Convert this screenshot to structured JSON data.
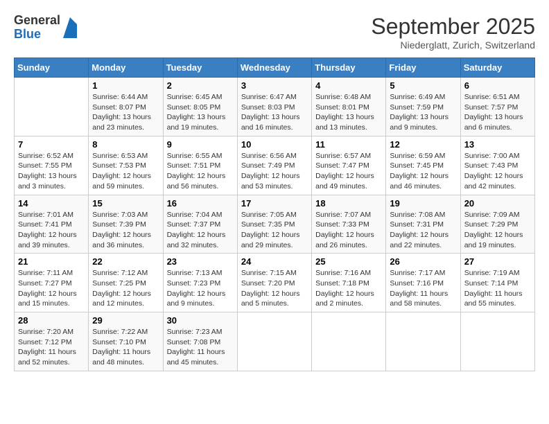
{
  "header": {
    "logo_general": "General",
    "logo_blue": "Blue",
    "month_title": "September 2025",
    "location": "Niederglatt, Zurich, Switzerland"
  },
  "days_of_week": [
    "Sunday",
    "Monday",
    "Tuesday",
    "Wednesday",
    "Thursday",
    "Friday",
    "Saturday"
  ],
  "weeks": [
    [
      {
        "day": "",
        "info": ""
      },
      {
        "day": "1",
        "info": "Sunrise: 6:44 AM\nSunset: 8:07 PM\nDaylight: 13 hours and 23 minutes."
      },
      {
        "day": "2",
        "info": "Sunrise: 6:45 AM\nSunset: 8:05 PM\nDaylight: 13 hours and 19 minutes."
      },
      {
        "day": "3",
        "info": "Sunrise: 6:47 AM\nSunset: 8:03 PM\nDaylight: 13 hours and 16 minutes."
      },
      {
        "day": "4",
        "info": "Sunrise: 6:48 AM\nSunset: 8:01 PM\nDaylight: 13 hours and 13 minutes."
      },
      {
        "day": "5",
        "info": "Sunrise: 6:49 AM\nSunset: 7:59 PM\nDaylight: 13 hours and 9 minutes."
      },
      {
        "day": "6",
        "info": "Sunrise: 6:51 AM\nSunset: 7:57 PM\nDaylight: 13 hours and 6 minutes."
      }
    ],
    [
      {
        "day": "7",
        "info": "Sunrise: 6:52 AM\nSunset: 7:55 PM\nDaylight: 13 hours and 3 minutes."
      },
      {
        "day": "8",
        "info": "Sunrise: 6:53 AM\nSunset: 7:53 PM\nDaylight: 12 hours and 59 minutes."
      },
      {
        "day": "9",
        "info": "Sunrise: 6:55 AM\nSunset: 7:51 PM\nDaylight: 12 hours and 56 minutes."
      },
      {
        "day": "10",
        "info": "Sunrise: 6:56 AM\nSunset: 7:49 PM\nDaylight: 12 hours and 53 minutes."
      },
      {
        "day": "11",
        "info": "Sunrise: 6:57 AM\nSunset: 7:47 PM\nDaylight: 12 hours and 49 minutes."
      },
      {
        "day": "12",
        "info": "Sunrise: 6:59 AM\nSunset: 7:45 PM\nDaylight: 12 hours and 46 minutes."
      },
      {
        "day": "13",
        "info": "Sunrise: 7:00 AM\nSunset: 7:43 PM\nDaylight: 12 hours and 42 minutes."
      }
    ],
    [
      {
        "day": "14",
        "info": "Sunrise: 7:01 AM\nSunset: 7:41 PM\nDaylight: 12 hours and 39 minutes."
      },
      {
        "day": "15",
        "info": "Sunrise: 7:03 AM\nSunset: 7:39 PM\nDaylight: 12 hours and 36 minutes."
      },
      {
        "day": "16",
        "info": "Sunrise: 7:04 AM\nSunset: 7:37 PM\nDaylight: 12 hours and 32 minutes."
      },
      {
        "day": "17",
        "info": "Sunrise: 7:05 AM\nSunset: 7:35 PM\nDaylight: 12 hours and 29 minutes."
      },
      {
        "day": "18",
        "info": "Sunrise: 7:07 AM\nSunset: 7:33 PM\nDaylight: 12 hours and 26 minutes."
      },
      {
        "day": "19",
        "info": "Sunrise: 7:08 AM\nSunset: 7:31 PM\nDaylight: 12 hours and 22 minutes."
      },
      {
        "day": "20",
        "info": "Sunrise: 7:09 AM\nSunset: 7:29 PM\nDaylight: 12 hours and 19 minutes."
      }
    ],
    [
      {
        "day": "21",
        "info": "Sunrise: 7:11 AM\nSunset: 7:27 PM\nDaylight: 12 hours and 15 minutes."
      },
      {
        "day": "22",
        "info": "Sunrise: 7:12 AM\nSunset: 7:25 PM\nDaylight: 12 hours and 12 minutes."
      },
      {
        "day": "23",
        "info": "Sunrise: 7:13 AM\nSunset: 7:23 PM\nDaylight: 12 hours and 9 minutes."
      },
      {
        "day": "24",
        "info": "Sunrise: 7:15 AM\nSunset: 7:20 PM\nDaylight: 12 hours and 5 minutes."
      },
      {
        "day": "25",
        "info": "Sunrise: 7:16 AM\nSunset: 7:18 PM\nDaylight: 12 hours and 2 minutes."
      },
      {
        "day": "26",
        "info": "Sunrise: 7:17 AM\nSunset: 7:16 PM\nDaylight: 11 hours and 58 minutes."
      },
      {
        "day": "27",
        "info": "Sunrise: 7:19 AM\nSunset: 7:14 PM\nDaylight: 11 hours and 55 minutes."
      }
    ],
    [
      {
        "day": "28",
        "info": "Sunrise: 7:20 AM\nSunset: 7:12 PM\nDaylight: 11 hours and 52 minutes."
      },
      {
        "day": "29",
        "info": "Sunrise: 7:22 AM\nSunset: 7:10 PM\nDaylight: 11 hours and 48 minutes."
      },
      {
        "day": "30",
        "info": "Sunrise: 7:23 AM\nSunset: 7:08 PM\nDaylight: 11 hours and 45 minutes."
      },
      {
        "day": "",
        "info": ""
      },
      {
        "day": "",
        "info": ""
      },
      {
        "day": "",
        "info": ""
      },
      {
        "day": "",
        "info": ""
      }
    ]
  ]
}
